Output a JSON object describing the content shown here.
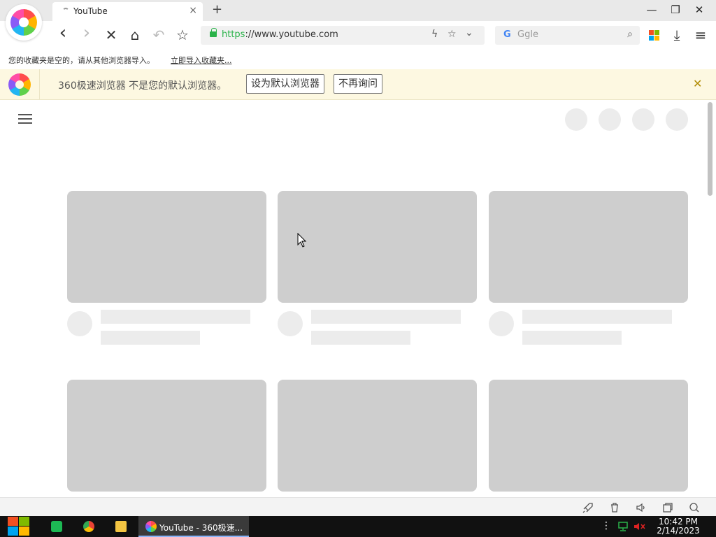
{
  "tab": {
    "title": "YouTube",
    "close_glyph": "×",
    "new_tab_glyph": "+"
  },
  "window_controls": {
    "minimize": "—",
    "maximize": "❐",
    "close": "✕"
  },
  "nav": {
    "back": "‹",
    "forward": "›",
    "stop": "✕",
    "home": "⌂",
    "undo": "↶",
    "favorite": "☆",
    "url_https": "https",
    "url_rest": "://www.youtube.com",
    "lightning": "ϟ",
    "star": "☆",
    "chevron": "⌄"
  },
  "search": {
    "engine_glyph": "G",
    "placeholder": "Ggle",
    "icon": "⌕"
  },
  "toolbar": {
    "download": "⤓",
    "menu": "≡"
  },
  "bookmarks": {
    "message": "您的收藏夹是空的，请从其他浏览器导入。",
    "import_link": "立即导入收藏夹..."
  },
  "infobar": {
    "text": "360极速浏览器 不是您的默认浏览器。",
    "set_default_label": "设为默认浏览器",
    "dont_ask_label": "不再询问",
    "close_glyph": "✕"
  },
  "statusbar": {
    "icons": [
      "rocket-icon",
      "trash-icon",
      "speaker-icon",
      "window-icon",
      "search-icon"
    ]
  },
  "taskbar": {
    "active_window_label": "YouTube - 360极速...",
    "more_glyph": "⋮",
    "time": "10:42 PM",
    "date": "2/14/2023"
  },
  "colors": {
    "accent_green": "#2bb34a",
    "infobar_bg": "#fdf8e1",
    "skeleton_thumb": "#cecece",
    "skeleton_light": "#ececec",
    "taskbar_bg": "#111111"
  }
}
